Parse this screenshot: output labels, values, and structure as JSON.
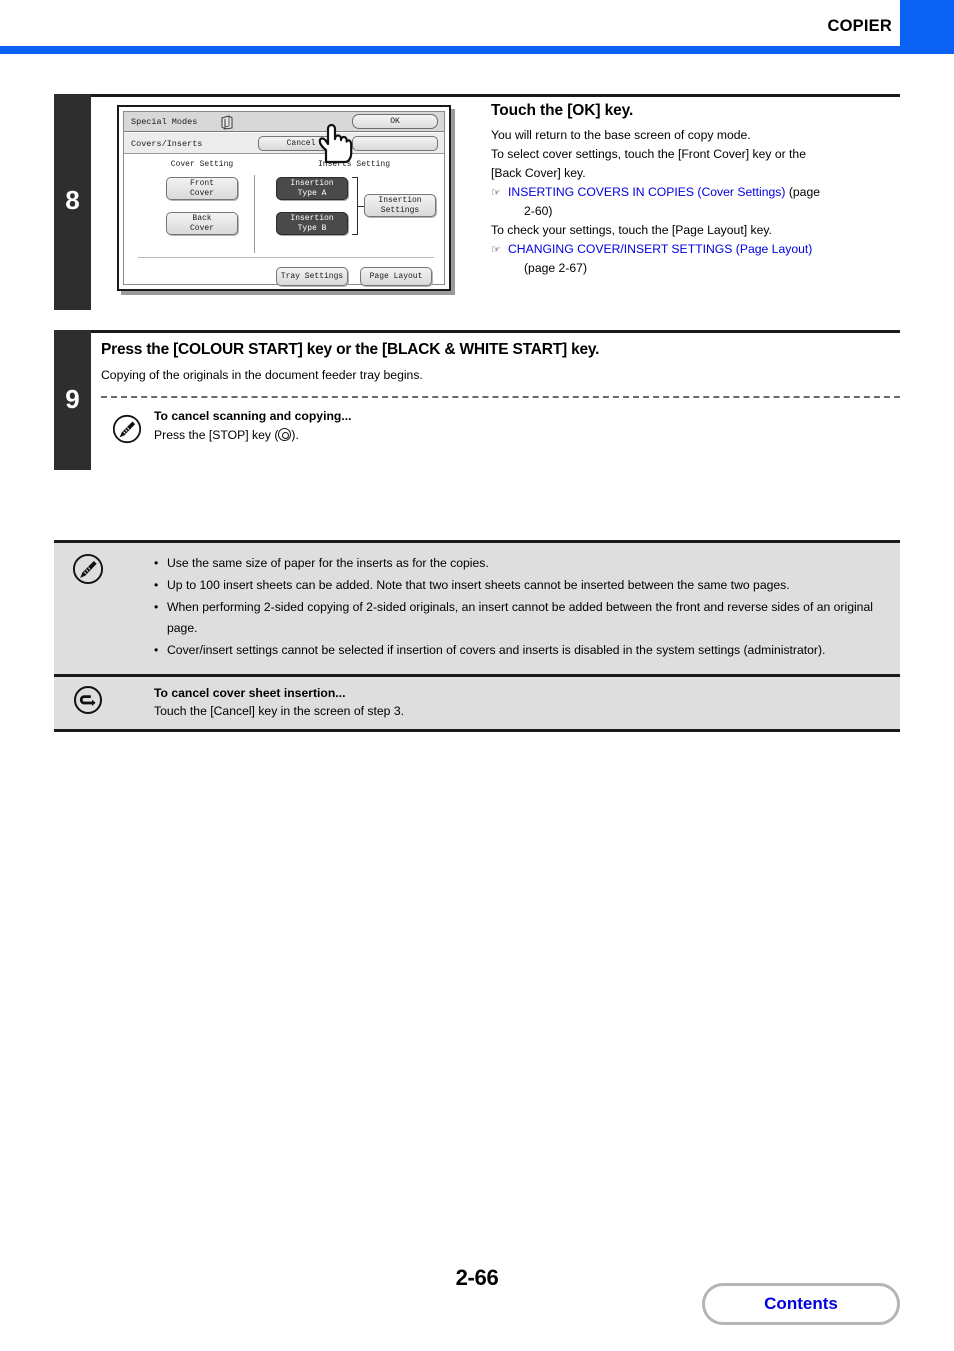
{
  "header": {
    "title": "COPIER",
    "accent_color": "#0b63f6"
  },
  "step8": {
    "number": "8",
    "heading": "Touch the [OK] key.",
    "lines": [
      "You will return to the base screen of copy mode.",
      "To select cover settings, touch the [Front Cover] key or the",
      "[Back Cover] key."
    ],
    "ref1_link": "INSERTING COVERS IN COPIES (Cover Settings)",
    "ref1_page": "(page",
    "ref1_page2": "2-60)",
    "line4": "To check your settings, touch the [Page Layout] key.",
    "ref2_link": "CHANGING COVER/INSERT SETTINGS (Page Layout)",
    "ref2_page": "(page 2-67)",
    "link_color": "#0000e0",
    "lcd": {
      "title": "Special Modes",
      "subtitle": "Covers/Inserts",
      "ok_label": "OK",
      "cancel_label": "Cancel",
      "cover_setting_label": "Cover Setting",
      "inserts_setting_label": "Inserts Setting",
      "front_cover": "Front\nCover",
      "back_cover": "Back\nCover",
      "insertion_type_a": "Insertion\nType A",
      "insertion_type_b": "Insertion\nType B",
      "insertion_settings": "Insertion\nSettings",
      "tray_settings": "Tray Settings",
      "page_layout": "Page Layout"
    }
  },
  "step9": {
    "number": "9",
    "heading": "Press the [COLOUR START] key or the [BLACK & WHITE START] key.",
    "subtext": "Copying of the originals in the document feeder tray begins.",
    "note_title": "To cancel scanning and copying...",
    "note_text_before": "Press the [STOP] key (",
    "note_text_after": ").",
    "icon": "pencil-note-icon"
  },
  "notes": {
    "icon": "pencil-note-icon",
    "items": [
      "Use the same size of paper for the inserts as for the copies.",
      "Up to 100 insert sheets can be added. Note that two insert sheets cannot be inserted between the same two pages.",
      "When performing 2-sided copying of 2-sided originals, an insert cannot be added between the front and reverse sides of an original page.",
      "Cover/insert settings cannot be selected if insertion of covers and inserts is disabled in the system settings (administrator)."
    ],
    "cancel_icon": "back-arrow-icon",
    "cancel_title": "To cancel cover sheet insertion...",
    "cancel_text": "Touch the [Cancel] key in the screen of step 3."
  },
  "footer": {
    "page_number": "2-66",
    "contents_label": "Contents",
    "contents_color": "#0000e0"
  }
}
